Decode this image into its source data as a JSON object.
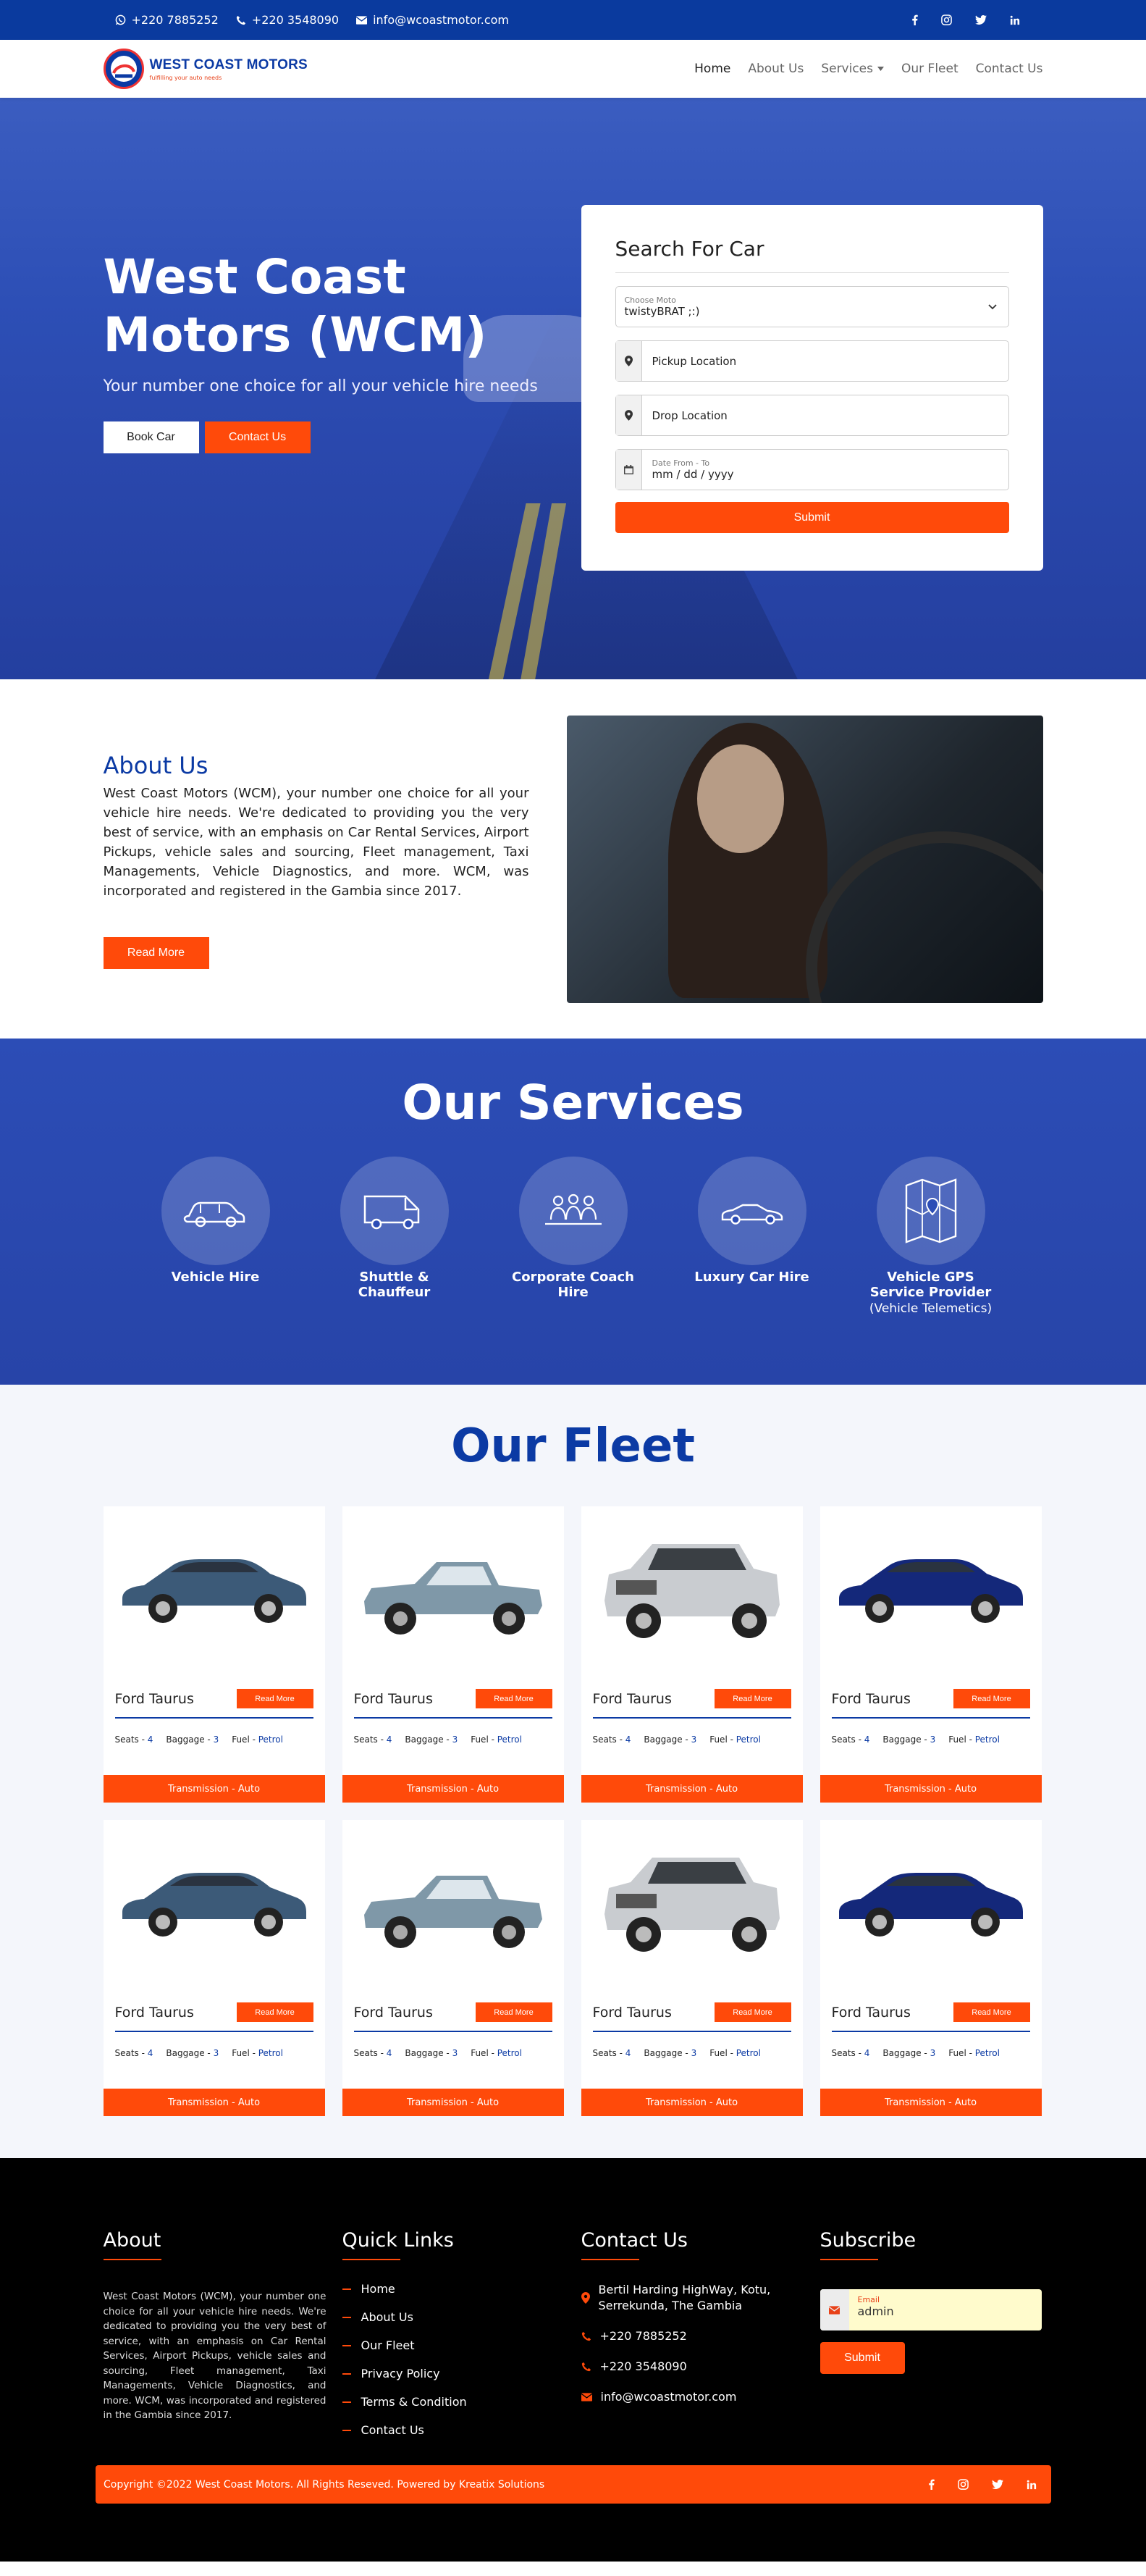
{
  "topbar": {
    "whatsapp": "+220 7885252",
    "phone": "+220 3548090",
    "email": "info@wcoastmotor.com"
  },
  "brand": {
    "name": "West Coast Motors",
    "tagline": "fulfilling your auto needs"
  },
  "nav": {
    "home": "Home",
    "about": "About Us",
    "services": "Services",
    "fleet": "Our Fleet",
    "contact": "Contact Us"
  },
  "hero": {
    "title": "West Coast Motors (WCM)",
    "subtitle": "Your number one choice for all your vehicle hire needs",
    "book_btn": "Book Car",
    "contact_btn": "Contact Us"
  },
  "search": {
    "title": "Search For Car",
    "choose_label": "Choose Moto",
    "choose_value": "twistyBRAT ;:)",
    "pickup": "Pickup Location",
    "drop": "Drop Location",
    "date_label": "Date From - To",
    "date_value": "mm / dd / yyyy",
    "submit": "Submit"
  },
  "about": {
    "title": "About Us",
    "text": "West Coast Motors (WCM), your number one choice for all your vehicle hire needs. We're dedicated to providing you the very best of service, with an emphasis on Car Rental Services, Airport Pickups, vehicle sales and sourcing, Fleet management, Taxi Managements, Vehicle Diagnostics, and more. WCM, was incorporated and registered in the Gambia since 2017.",
    "btn": "Read More"
  },
  "services": {
    "title": "Our Services",
    "items": [
      {
        "name": "Vehicle Hire",
        "sub": "",
        "icon": "car-icon"
      },
      {
        "name": "Shuttle & Chauffeur",
        "sub": "",
        "icon": "van-icon"
      },
      {
        "name": "Corporate Coach Hire",
        "sub": "",
        "icon": "group-icon"
      },
      {
        "name": "Luxury Car Hire",
        "sub": "",
        "icon": "convertible-icon"
      },
      {
        "name": "Vehicle GPS Service Provider",
        "sub": "(Vehicle Telemetics)",
        "icon": "map-icon"
      }
    ]
  },
  "fleet": {
    "title": "Our Fleet",
    "cars": [
      {
        "name": "Ford Taurus",
        "btn": "Read More",
        "seats_l": "Seats - ",
        "seats": "4",
        "bag_l": "Baggage - ",
        "bag": "3",
        "fuel_l": "Fuel - ",
        "fuel": "Petrol",
        "trans": "Transmission - Auto",
        "kind": "sedan",
        "color": "#3c5a78"
      },
      {
        "name": "Ford Taurus",
        "btn": "Read More",
        "seats_l": "Seats - ",
        "seats": "4",
        "bag_l": "Baggage - ",
        "bag": "3",
        "fuel_l": "Fuel - ",
        "fuel": "Petrol",
        "trans": "Transmission - Auto",
        "kind": "pickup",
        "color": "#7f98a8"
      },
      {
        "name": "Ford Taurus",
        "btn": "Read More",
        "seats_l": "Seats - ",
        "seats": "4",
        "bag_l": "Baggage - ",
        "bag": "3",
        "fuel_l": "Fuel - ",
        "fuel": "Petrol",
        "trans": "Transmission - Auto",
        "kind": "suv",
        "color": "#c9ccd0"
      },
      {
        "name": "Ford Taurus",
        "btn": "Read More",
        "seats_l": "Seats - ",
        "seats": "4",
        "bag_l": "Baggage - ",
        "bag": "3",
        "fuel_l": "Fuel - ",
        "fuel": "Petrol",
        "trans": "Transmission - Auto",
        "kind": "sedan",
        "color": "#14287a"
      },
      {
        "name": "Ford Taurus",
        "btn": "Read More",
        "seats_l": "Seats - ",
        "seats": "4",
        "bag_l": "Baggage - ",
        "bag": "3",
        "fuel_l": "Fuel - ",
        "fuel": "Petrol",
        "trans": "Transmission - Auto",
        "kind": "sedan",
        "color": "#3c5a78"
      },
      {
        "name": "Ford Taurus",
        "btn": "Read More",
        "seats_l": "Seats - ",
        "seats": "4",
        "bag_l": "Baggage - ",
        "bag": "3",
        "fuel_l": "Fuel - ",
        "fuel": "Petrol",
        "trans": "Transmission - Auto",
        "kind": "pickup",
        "color": "#7f98a8"
      },
      {
        "name": "Ford Taurus",
        "btn": "Read More",
        "seats_l": "Seats - ",
        "seats": "4",
        "bag_l": "Baggage - ",
        "bag": "3",
        "fuel_l": "Fuel - ",
        "fuel": "Petrol",
        "trans": "Transmission - Auto",
        "kind": "suv",
        "color": "#c9ccd0"
      },
      {
        "name": "Ford Taurus",
        "btn": "Read More",
        "seats_l": "Seats - ",
        "seats": "4",
        "bag_l": "Baggage - ",
        "bag": "3",
        "fuel_l": "Fuel - ",
        "fuel": "Petrol",
        "trans": "Transmission - Auto",
        "kind": "sedan",
        "color": "#14287a"
      }
    ]
  },
  "footer": {
    "about_title": "About",
    "about_text": "West Coast Motors (WCM), your number one choice for all your vehicle hire needs. We're dedicated to providing you the very best of service, with an emphasis on Car Rental Services, Airport Pickups, vehicle sales and sourcing, Fleet management, Taxi Managements, Vehicle Diagnostics, and more. WCM, was incorporated and registered in the Gambia since 2017.",
    "links_title": "Quick Links",
    "links": [
      "Home",
      "About Us",
      "Our Fleet",
      "Privacy Policy",
      "Terms & Condition",
      "Contact Us"
    ],
    "contact_title": "Contact Us",
    "address": "Bertil Harding HighWay, Kotu, Serrekunda, The Gambia",
    "phone1": "+220 7885252",
    "phone2": "+220 3548090",
    "email": "info@wcoastmotor.com",
    "subscribe_title": "Subscribe",
    "email_label": "Email",
    "email_value": "admin",
    "submit": "Submit",
    "copyright": "Copyright ©2022 West Coast Motors. All Rights Reseved. Powered by Kreatix Solutions"
  },
  "colors": {
    "primary": "#0b3aa4",
    "accent": "#ff4a0a"
  }
}
